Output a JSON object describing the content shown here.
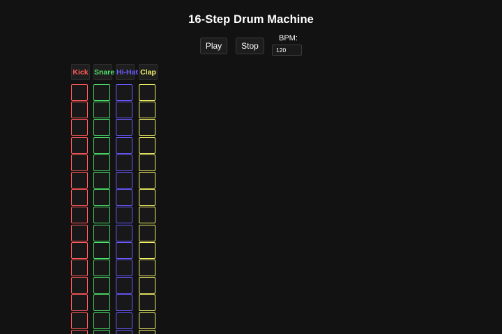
{
  "title": "16-Step Drum Machine",
  "controls": {
    "play_label": "Play",
    "stop_label": "Stop",
    "bpm_label": "BPM:",
    "bpm_value": "120"
  },
  "tracks": [
    {
      "name": "Kick",
      "color": "#ff5a5a"
    },
    {
      "name": "Snare",
      "color": "#4fe36a"
    },
    {
      "name": "Hi-Hat",
      "color": "#6a5cff"
    },
    {
      "name": "Clap",
      "color": "#f2f26b"
    }
  ],
  "colors": {
    "background": "#121212",
    "text": "#ffffff"
  },
  "steps": 16
}
